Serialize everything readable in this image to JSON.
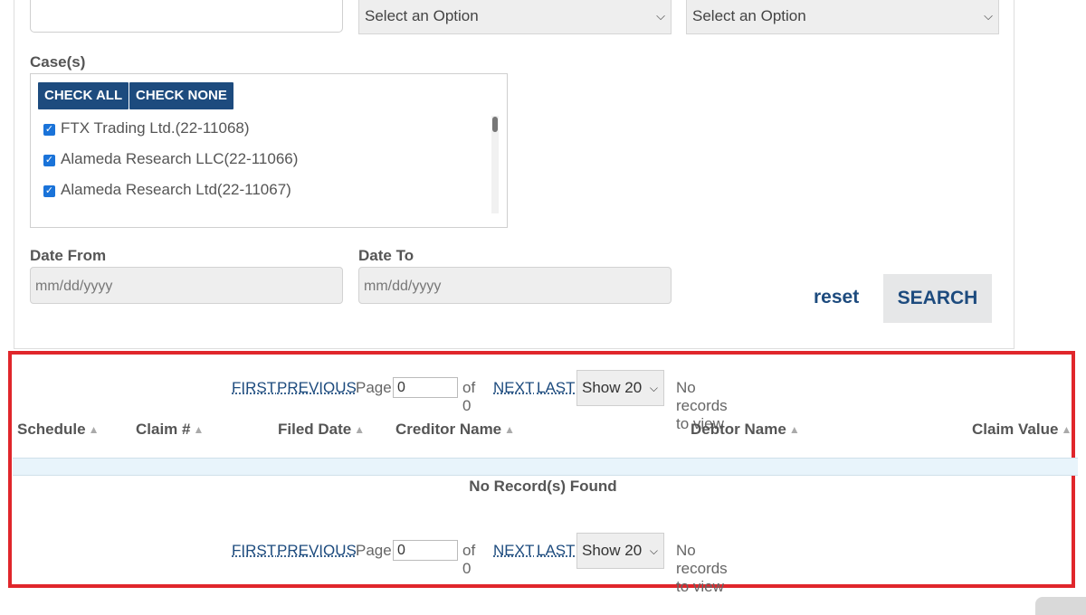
{
  "filters": {
    "select1": "Select an Option",
    "select2": "Select an Option",
    "cases_label": "Case(s)",
    "check_all": "CHECK ALL",
    "check_none": "CHECK NONE",
    "cases": [
      "FTX Trading Ltd.(22-11068)",
      "Alameda Research LLC(22-11066)",
      "Alameda Research Ltd(22-11067)"
    ],
    "date_from_label": "Date From",
    "date_to_label": "Date To",
    "date_from_placeholder": "mm/dd/yyyy",
    "date_to_placeholder": "mm/dd/yyyy",
    "reset": "reset",
    "search": "SEARCH"
  },
  "pager": {
    "first": "FIRST",
    "previous": "PREVIOUS",
    "page": "Page",
    "page_value": "0",
    "of": "of 0",
    "next": "NEXT",
    "last": "LAST",
    "show": "Show 20",
    "status": "No records to view"
  },
  "table": {
    "columns": [
      "Schedule",
      "Claim #",
      "Filed Date",
      "Creditor Name",
      "Debtor Name",
      "Claim Value"
    ],
    "empty": "No Record(s) Found"
  },
  "colors": {
    "accent": "#1d4b7e",
    "highlight": "#e0262b"
  }
}
